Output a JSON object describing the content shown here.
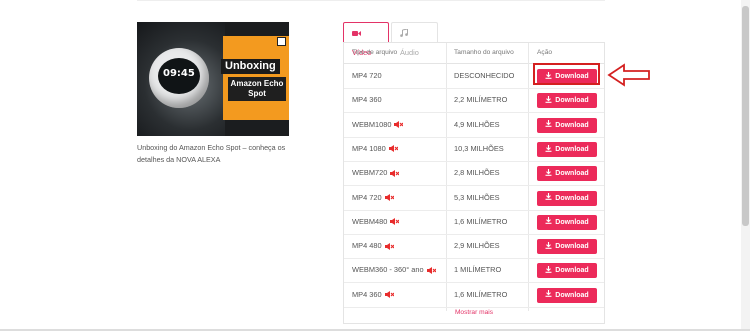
{
  "thumbnail": {
    "clock_text": "09:45",
    "title_overlay": "Unboxing",
    "subtitle_overlay": "Amazon Echo Spot"
  },
  "caption": "Unboxing do Amazon Echo Spot – conheça os detalhes da NOVA ALEXA",
  "tabs": [
    {
      "label": "Vídeo",
      "icon": "video-icon",
      "active": true
    },
    {
      "label": "Áudio",
      "icon": "music-note-icon",
      "active": false
    }
  ],
  "table": {
    "headers": [
      "Tipo de arquivo",
      "Tamanho do arquivo",
      "Ação"
    ],
    "rows": [
      {
        "type": "MP4 720",
        "size": "DESCONHECIDO",
        "muted": false,
        "action": "Download"
      },
      {
        "type": "MP4 360",
        "size": "2,2 MILÍMETRO",
        "muted": false,
        "action": "Download"
      },
      {
        "type": "WEBM1080",
        "size": "4,9 MILHÕES",
        "muted": true,
        "action": "Download"
      },
      {
        "type": "MP4 1080",
        "size": "10,3 MILHÕES",
        "muted": true,
        "action": "Download"
      },
      {
        "type": "WEBM720",
        "size": "2,8 MILHÕES",
        "muted": true,
        "action": "Download"
      },
      {
        "type": "MP4 720",
        "size": "5,3 MILHÕES",
        "muted": true,
        "action": "Download"
      },
      {
        "type": "WEBM480",
        "size": "1,6 MILÍMETRO",
        "muted": true,
        "action": "Download"
      },
      {
        "type": "MP4 480",
        "size": "2,9 MILHÕES",
        "muted": true,
        "action": "Download"
      },
      {
        "type": "WEBM360 - 360° ano",
        "size": "1 MILÍMETRO",
        "muted": true,
        "action": "Download"
      },
      {
        "type": "MP4 360",
        "size": "1,6 MILÍMETRO",
        "muted": true,
        "action": "Download"
      }
    ],
    "show_more": "Mostrar mais"
  },
  "colors": {
    "accent": "#ec2a5a",
    "highlight": "#d42020"
  }
}
